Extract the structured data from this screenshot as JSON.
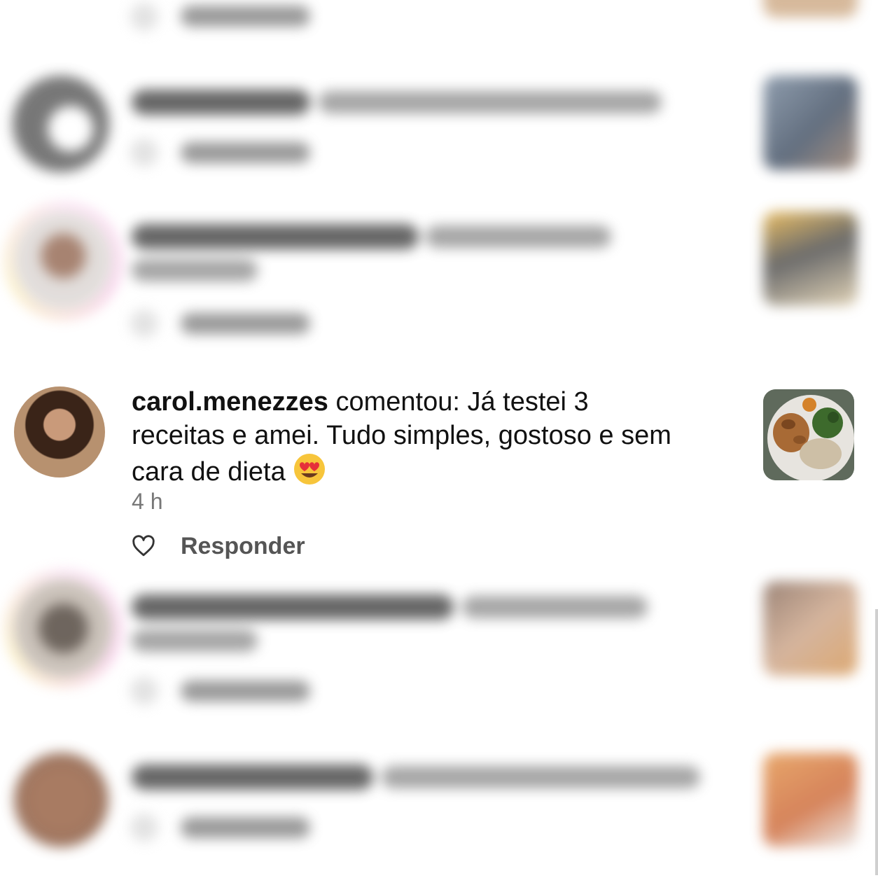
{
  "featured_comment": {
    "username": "carol.menezzes",
    "message_line1": " comentou: Já testei 3",
    "message_line2": "receitas e amei. Tudo simples, gostoso e sem",
    "message_line3": "cara de dieta ",
    "emoji": "heart-eyes-emoji",
    "time": "4 h",
    "reply_label": "Responder"
  },
  "colors": {
    "text": "#111111",
    "muted": "#777777",
    "reply": "#555555",
    "ring_pink": "#f2a2d8",
    "ring_yellow": "#f8e08a"
  }
}
